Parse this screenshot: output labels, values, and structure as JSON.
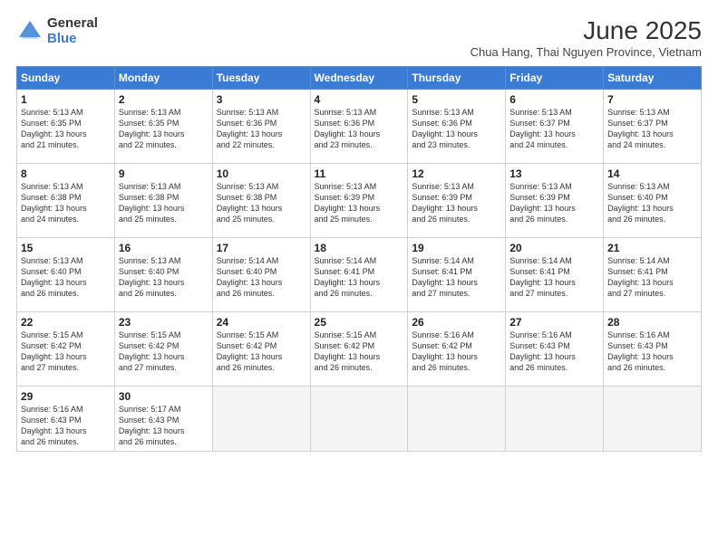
{
  "logo": {
    "general": "General",
    "blue": "Blue"
  },
  "title": "June 2025",
  "subtitle": "Chua Hang, Thai Nguyen Province, Vietnam",
  "days": [
    "Sunday",
    "Monday",
    "Tuesday",
    "Wednesday",
    "Thursday",
    "Friday",
    "Saturday"
  ],
  "weeks": [
    [
      {
        "day": "1",
        "sunrise": "5:13 AM",
        "sunset": "6:35 PM",
        "daylight": "13 hours and 21 minutes."
      },
      {
        "day": "2",
        "sunrise": "5:13 AM",
        "sunset": "6:35 PM",
        "daylight": "13 hours and 22 minutes."
      },
      {
        "day": "3",
        "sunrise": "5:13 AM",
        "sunset": "6:36 PM",
        "daylight": "13 hours and 22 minutes."
      },
      {
        "day": "4",
        "sunrise": "5:13 AM",
        "sunset": "6:36 PM",
        "daylight": "13 hours and 23 minutes."
      },
      {
        "day": "5",
        "sunrise": "5:13 AM",
        "sunset": "6:36 PM",
        "daylight": "13 hours and 23 minutes."
      },
      {
        "day": "6",
        "sunrise": "5:13 AM",
        "sunset": "6:37 PM",
        "daylight": "13 hours and 24 minutes."
      },
      {
        "day": "7",
        "sunrise": "5:13 AM",
        "sunset": "6:37 PM",
        "daylight": "13 hours and 24 minutes."
      }
    ],
    [
      {
        "day": "8",
        "sunrise": "5:13 AM",
        "sunset": "6:38 PM",
        "daylight": "13 hours and 24 minutes."
      },
      {
        "day": "9",
        "sunrise": "5:13 AM",
        "sunset": "6:38 PM",
        "daylight": "13 hours and 25 minutes."
      },
      {
        "day": "10",
        "sunrise": "5:13 AM",
        "sunset": "6:38 PM",
        "daylight": "13 hours and 25 minutes."
      },
      {
        "day": "11",
        "sunrise": "5:13 AM",
        "sunset": "6:39 PM",
        "daylight": "13 hours and 25 minutes."
      },
      {
        "day": "12",
        "sunrise": "5:13 AM",
        "sunset": "6:39 PM",
        "daylight": "13 hours and 26 minutes."
      },
      {
        "day": "13",
        "sunrise": "5:13 AM",
        "sunset": "6:39 PM",
        "daylight": "13 hours and 26 minutes."
      },
      {
        "day": "14",
        "sunrise": "5:13 AM",
        "sunset": "6:40 PM",
        "daylight": "13 hours and 26 minutes."
      }
    ],
    [
      {
        "day": "15",
        "sunrise": "5:13 AM",
        "sunset": "6:40 PM",
        "daylight": "13 hours and 26 minutes."
      },
      {
        "day": "16",
        "sunrise": "5:13 AM",
        "sunset": "6:40 PM",
        "daylight": "13 hours and 26 minutes."
      },
      {
        "day": "17",
        "sunrise": "5:14 AM",
        "sunset": "6:40 PM",
        "daylight": "13 hours and 26 minutes."
      },
      {
        "day": "18",
        "sunrise": "5:14 AM",
        "sunset": "6:41 PM",
        "daylight": "13 hours and 26 minutes."
      },
      {
        "day": "19",
        "sunrise": "5:14 AM",
        "sunset": "6:41 PM",
        "daylight": "13 hours and 27 minutes."
      },
      {
        "day": "20",
        "sunrise": "5:14 AM",
        "sunset": "6:41 PM",
        "daylight": "13 hours and 27 minutes."
      },
      {
        "day": "21",
        "sunrise": "5:14 AM",
        "sunset": "6:41 PM",
        "daylight": "13 hours and 27 minutes."
      }
    ],
    [
      {
        "day": "22",
        "sunrise": "5:15 AM",
        "sunset": "6:42 PM",
        "daylight": "13 hours and 27 minutes."
      },
      {
        "day": "23",
        "sunrise": "5:15 AM",
        "sunset": "6:42 PM",
        "daylight": "13 hours and 27 minutes."
      },
      {
        "day": "24",
        "sunrise": "5:15 AM",
        "sunset": "6:42 PM",
        "daylight": "13 hours and 26 minutes."
      },
      {
        "day": "25",
        "sunrise": "5:15 AM",
        "sunset": "6:42 PM",
        "daylight": "13 hours and 26 minutes."
      },
      {
        "day": "26",
        "sunrise": "5:16 AM",
        "sunset": "6:42 PM",
        "daylight": "13 hours and 26 minutes."
      },
      {
        "day": "27",
        "sunrise": "5:16 AM",
        "sunset": "6:43 PM",
        "daylight": "13 hours and 26 minutes."
      },
      {
        "day": "28",
        "sunrise": "5:16 AM",
        "sunset": "6:43 PM",
        "daylight": "13 hours and 26 minutes."
      }
    ],
    [
      {
        "day": "29",
        "sunrise": "5:16 AM",
        "sunset": "6:43 PM",
        "daylight": "13 hours and 26 minutes."
      },
      {
        "day": "30",
        "sunrise": "5:17 AM",
        "sunset": "6:43 PM",
        "daylight": "13 hours and 26 minutes."
      },
      null,
      null,
      null,
      null,
      null
    ]
  ],
  "labels": {
    "sunrise": "Sunrise:",
    "sunset": "Sunset:",
    "daylight": "Daylight:"
  }
}
